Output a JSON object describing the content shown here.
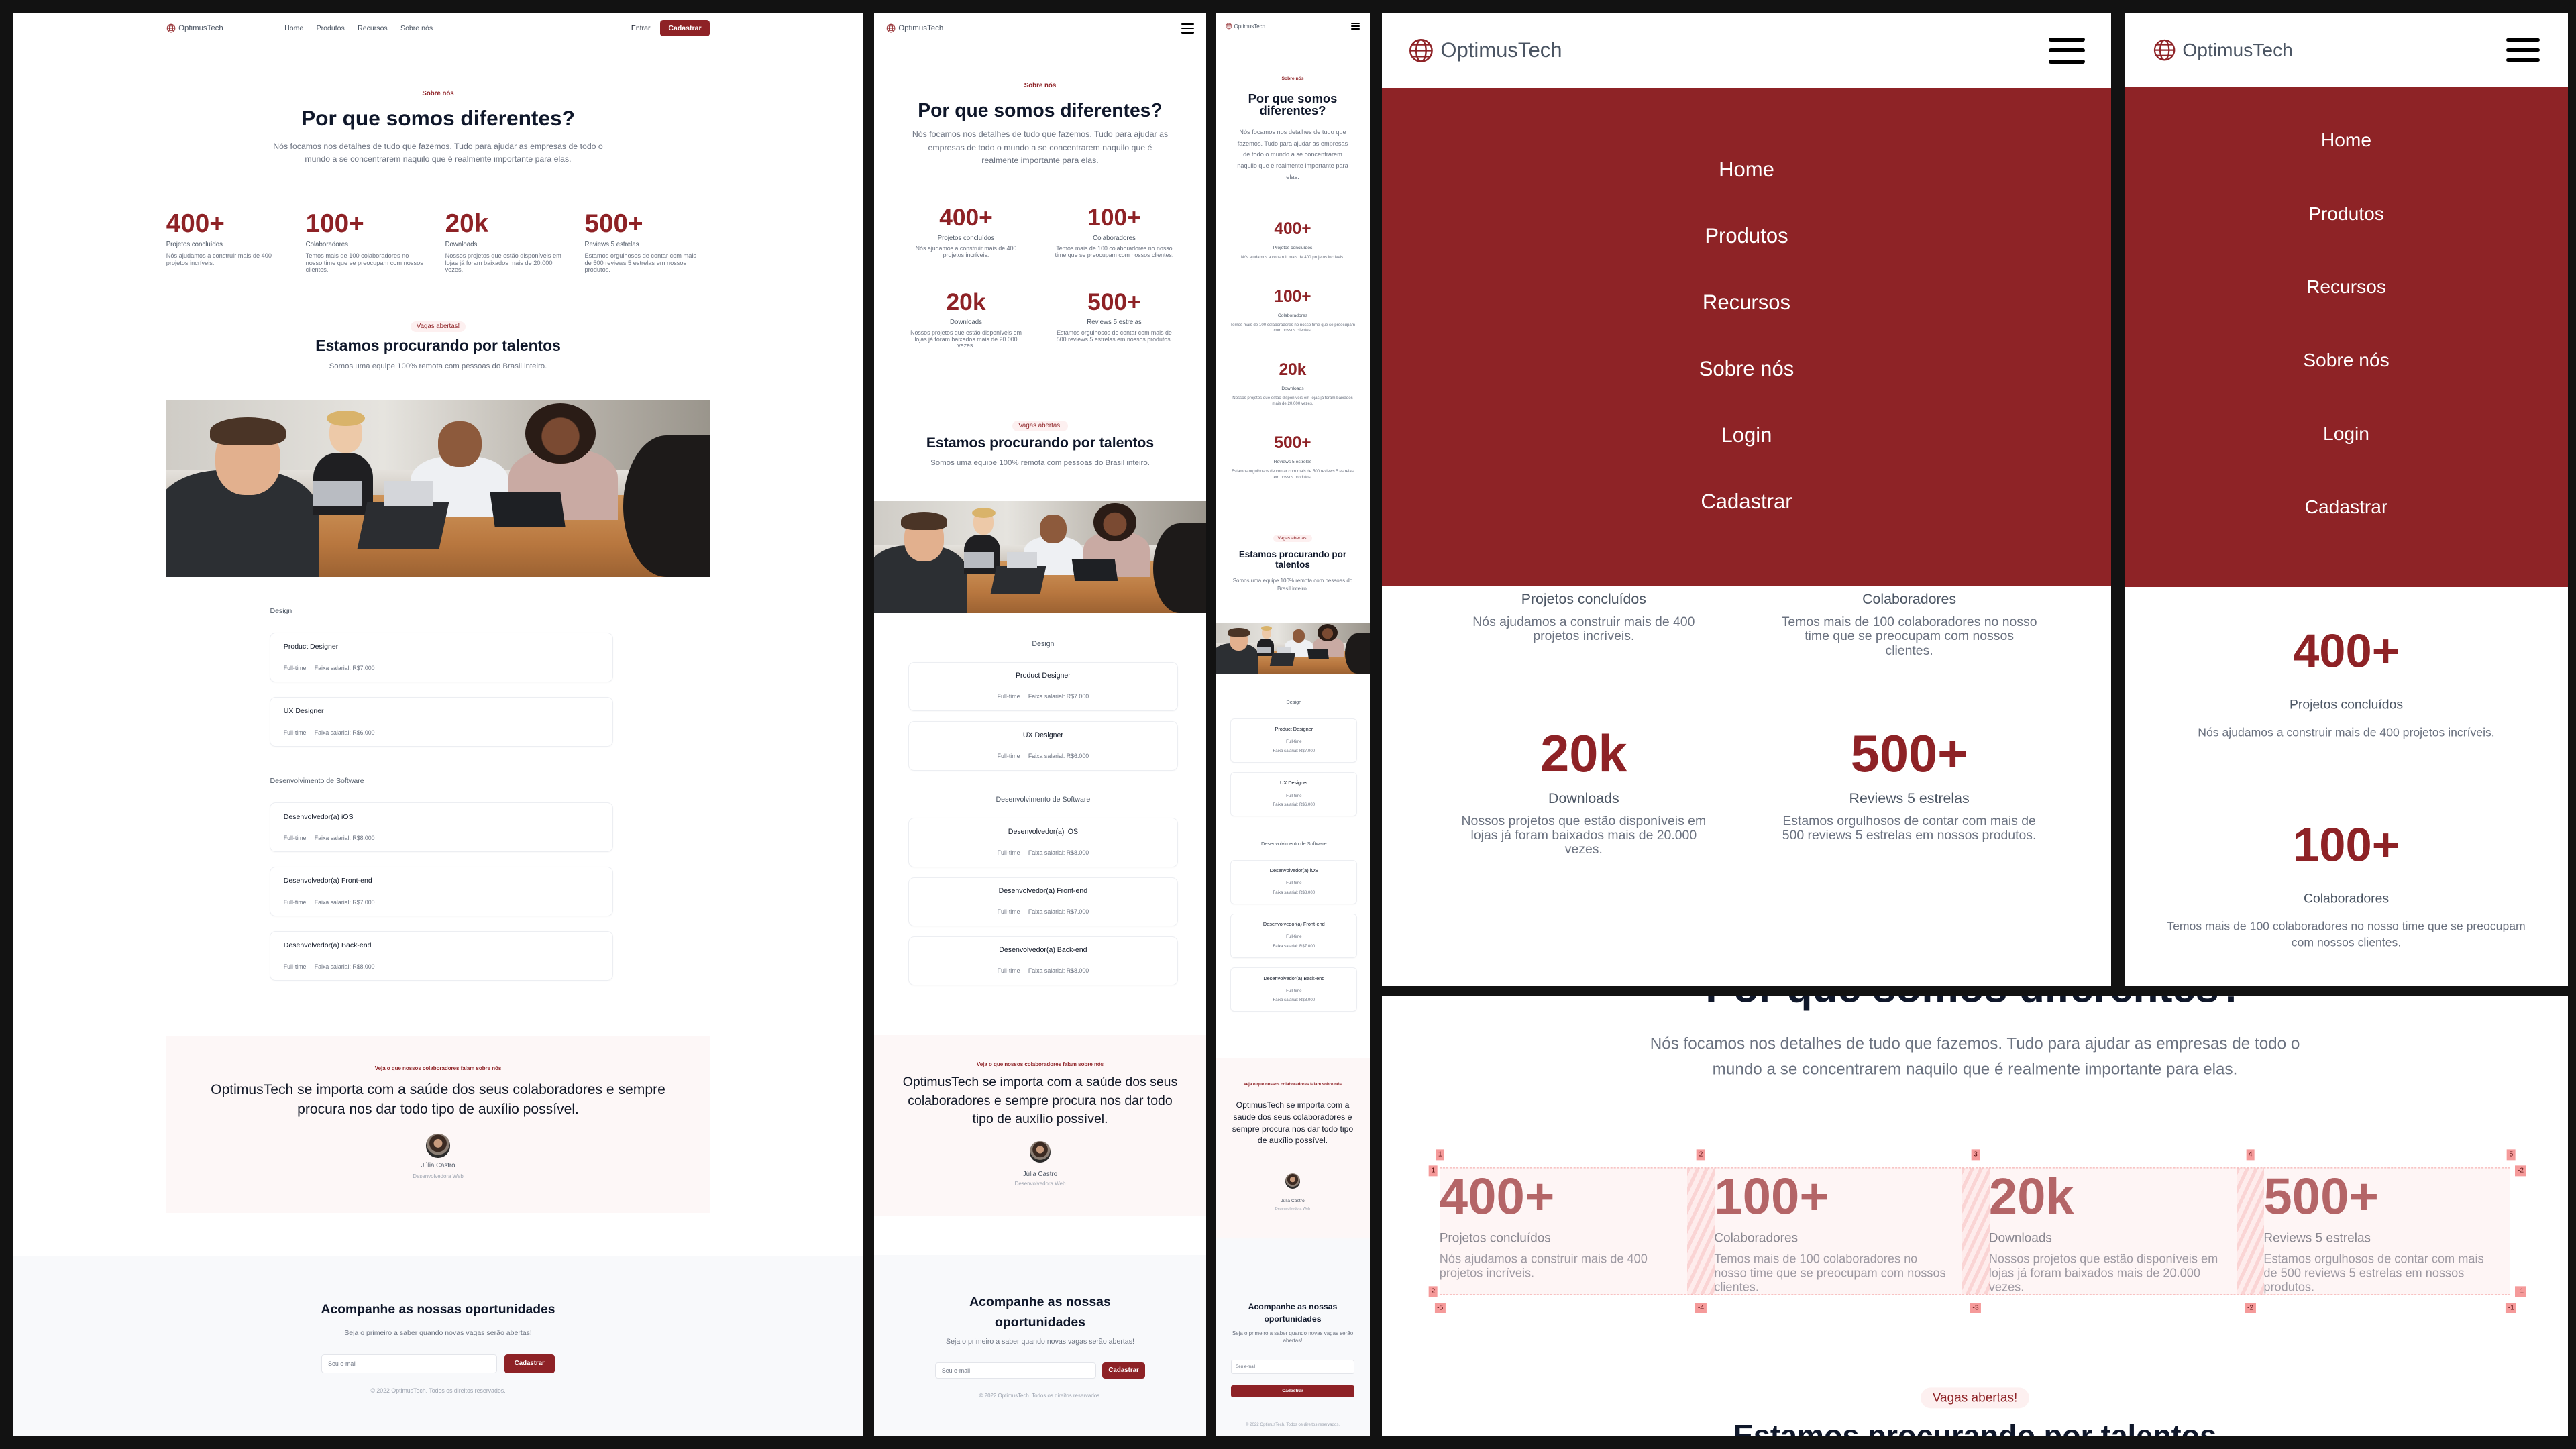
{
  "brand": {
    "name": "OptimusTech",
    "logo_icon": "globe-icon"
  },
  "colors": {
    "brand": "#8e2226",
    "menu_background": "#8e2326",
    "testimonial_background": "#fdf7f7",
    "newsletter_background": "#f8f9fb",
    "page_background": "#121212"
  },
  "nav": {
    "links": [
      "Home",
      "Produtos",
      "Recursos",
      "Sobre nós"
    ],
    "login": "Entrar",
    "signup": "Cadastrar",
    "menu_icon": "hamburger-icon"
  },
  "mobile_menu": {
    "items": [
      "Home",
      "Produtos",
      "Recursos",
      "Sobre nós",
      "Login",
      "Cadastrar"
    ]
  },
  "about": {
    "eyebrow": "Sobre nós",
    "title": "Por que somos diferentes?",
    "lead": "Nós focamos nos detalhes de tudo que fazemos. Tudo para ajudar as empresas de todo o mundo a se concentrarem naquilo que é realmente importante para elas."
  },
  "stats": [
    {
      "value": "400+",
      "label": "Projetos concluídos",
      "desc": "Nós ajudamos a construir mais de 400 projetos incríveis."
    },
    {
      "value": "100+",
      "label": "Colaboradores",
      "desc": "Temos mais de 100 colaboradores no nosso time que se preocupam com nossos clientes."
    },
    {
      "value": "20k",
      "label": "Downloads",
      "desc": "Nossos projetos que estão disponíveis em lojas já foram baixados mais de 20.000 vezes."
    },
    {
      "value": "500+",
      "label": "Reviews 5 estrelas",
      "desc": "Estamos orgulhosos de contar com mais de 500 reviews 5 estrelas em nossos produtos."
    }
  ],
  "jobs": {
    "eyebrow": "Vagas abertas!",
    "title": "Estamos procurando por talentos",
    "subtitle": "Somos uma equipe 100% remota com pessoas do Brasil inteiro.",
    "groups": [
      {
        "name": "Design",
        "items": [
          {
            "title": "Product Designer",
            "type": "Full-time",
            "salary": "Faixa salarial: R$7.000"
          },
          {
            "title": "UX Designer",
            "type": "Full-time",
            "salary": "Faixa salarial: R$6.000"
          }
        ]
      },
      {
        "name": "Desenvolvimento de Software",
        "items": [
          {
            "title": "Desenvolvedor(a) iOS",
            "type": "Full-time",
            "salary": "Faixa salarial: R$8.000"
          },
          {
            "title": "Desenvolvedor(a) Front-end",
            "type": "Full-time",
            "salary": "Faixa salarial: R$7.000"
          },
          {
            "title": "Desenvolvedor(a) Back-end",
            "type": "Full-time",
            "salary": "Faixa salarial: R$8.000"
          }
        ]
      }
    ]
  },
  "testimonial": {
    "eyebrow": "Veja o que nossos colaboradores falam sobre nós",
    "quote": "OptimusTech se importa com a saúde dos seus colaboradores e sempre procura nos dar todo tipo de auxílio possível.",
    "name": "Júlia Castro",
    "role": "Desenvolvedora Web"
  },
  "newsletter": {
    "title": "Acompanhe as nossas oportunidades",
    "subtitle": "Seja o primeiro a saber quando novas vagas serão abertas!",
    "email_placeholder": "Seu e-mail",
    "email_value": "",
    "button": "Cadastrar"
  },
  "footer": {
    "copyright": "© 2022 OptimusTech. Todos os direitos reservados."
  },
  "grid_overlay": {
    "column_lines": [
      "1",
      "2",
      "3",
      "4",
      "5"
    ],
    "column_lines_negative": [
      "-5",
      "-4",
      "-3",
      "-2",
      "-1"
    ],
    "row_lines": [
      "1",
      "2"
    ],
    "row_lines_negative": [
      "-2",
      "-1"
    ]
  }
}
